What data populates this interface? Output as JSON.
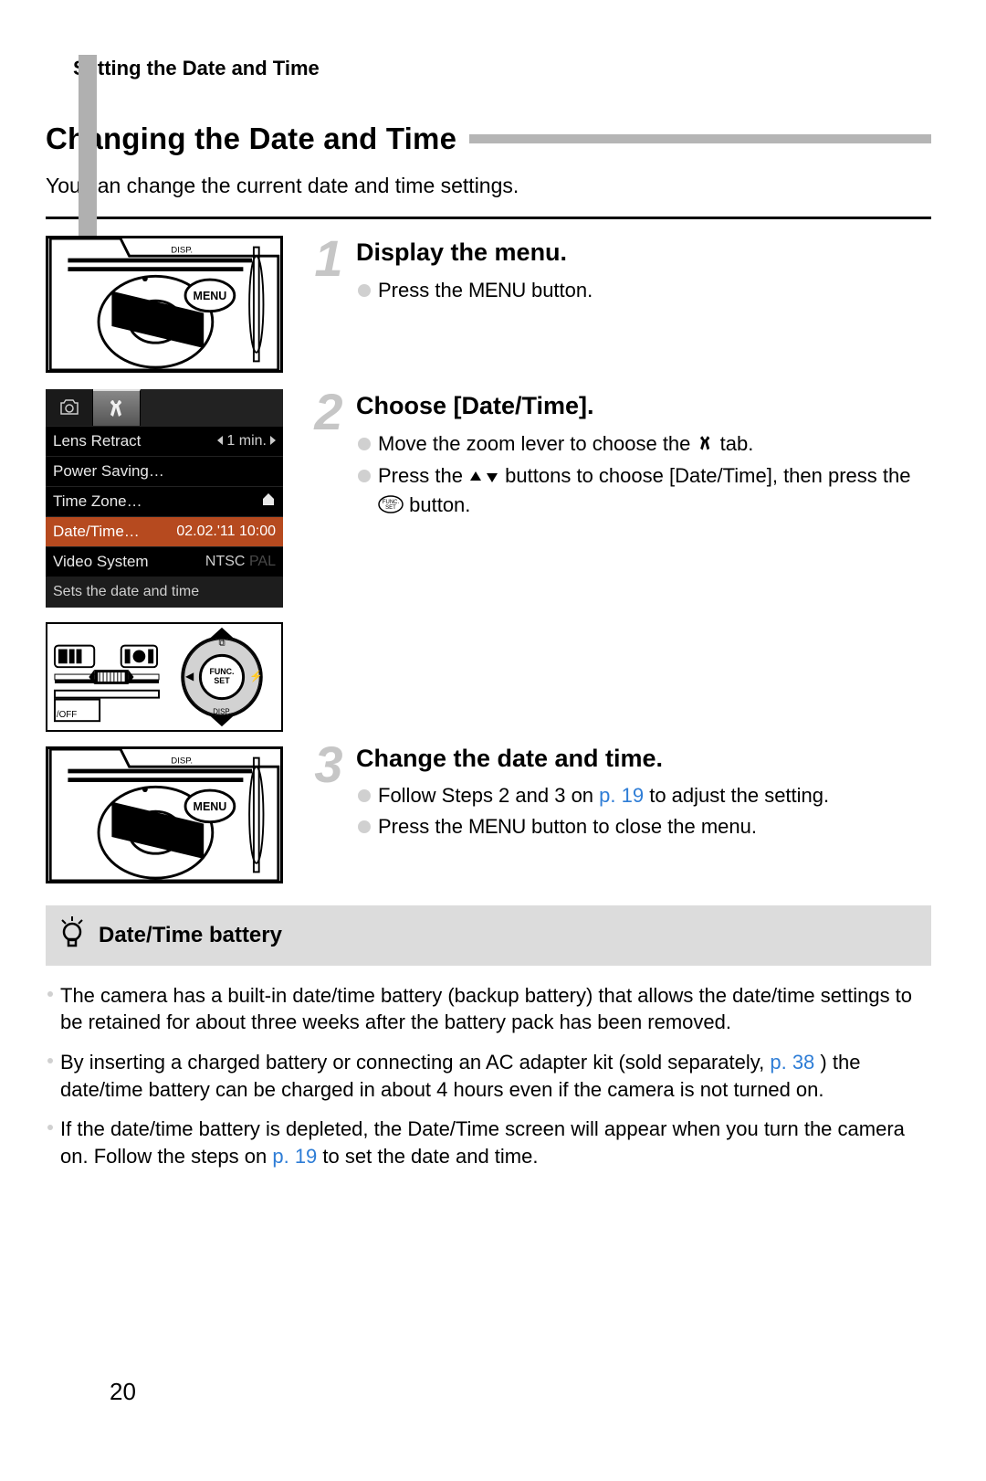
{
  "breadcrumb": "Setting the Date and Time",
  "section_title": "Changing the Date and Time",
  "section_intro": "You can change the current date and time settings.",
  "steps": {
    "s1": {
      "num": "1",
      "title": "Display the menu.",
      "bullet1a": "Press the ",
      "bullet1b": " button."
    },
    "s2": {
      "num": "2",
      "title": "Choose [Date/Time].",
      "bullet1a": "Move the zoom lever to choose the ",
      "bullet1b": " tab.",
      "bullet2a": "Press the ",
      "bullet2b": " buttons to choose [Date/Time], then press the ",
      "bullet2c": " button."
    },
    "s3": {
      "num": "3",
      "title": "Change the date and time.",
      "bullet1a": "Follow Steps 2 and 3 on ",
      "bullet1link": "p. 19",
      "bullet1b": " to adjust the setting.",
      "bullet2a": "Press the ",
      "bullet2b": " button to close the menu."
    }
  },
  "menu_screenshot": {
    "rows": [
      {
        "label": "Lens Retract",
        "value": "1 min."
      },
      {
        "label": "Power Saving…",
        "value": ""
      },
      {
        "label": "Time Zone…",
        "value": ""
      },
      {
        "label": "Date/Time…",
        "value": "02.02.'11 10:00"
      },
      {
        "label": "Video System",
        "value": "NTSC"
      }
    ],
    "caption": "Sets the date and time"
  },
  "tip": {
    "title": "Date/Time battery",
    "items": {
      "i1": "The camera has a built-in date/time battery (backup battery) that allows the date/time settings to be retained for about three weeks after the battery pack has been removed.",
      "i2a": "By inserting a charged battery or connecting an AC adapter kit (sold separately, ",
      "i2link": "p. 38",
      "i2b": ") the date/time battery can be charged in about 4 hours even if the camera is not turned on.",
      "i3a": "If the date/time battery is depleted, the Date/Time screen will appear when you turn the camera on. Follow the steps on ",
      "i3link": "p. 19",
      "i3b": " to set the date and time."
    }
  },
  "labels": {
    "menu_word": "MENU",
    "func_set": "FUNC\nSET",
    "video_pal": "PAL"
  },
  "page_number": "20"
}
